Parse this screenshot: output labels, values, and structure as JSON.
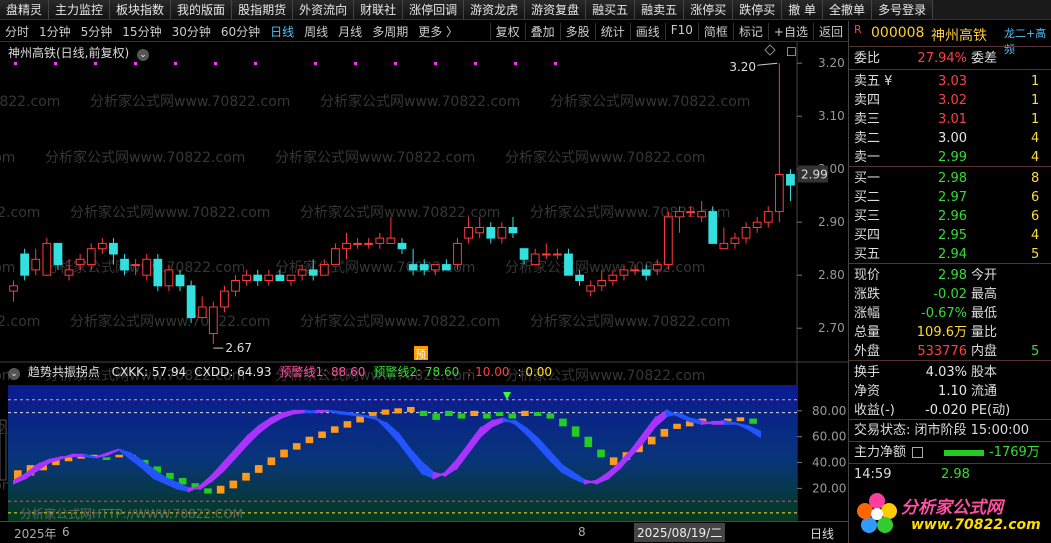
{
  "toolbar": [
    "盘精灵",
    "主力监控",
    "板块指数",
    "我的版面",
    "股指期货",
    "外资流向",
    "财联社",
    "涨停回调",
    "游资龙虎",
    "游资复盘",
    "融买五",
    "融卖五",
    "涨停买",
    "跌停买",
    "撤 单",
    "全撤单",
    "多号登录"
  ],
  "timeframes": [
    "分时",
    "1分钟",
    "5分钟",
    "15分钟",
    "30分钟",
    "60分钟",
    "日线",
    "周线",
    "月线",
    "多周期",
    "更多 〉"
  ],
  "active_timeframe": "日线",
  "right_tools": [
    "复权",
    "叠加",
    "多股",
    "统计",
    "画线",
    "F10",
    "简框",
    "标记",
    "+自选",
    "返回"
  ],
  "chart_title": "神州高铁(日线,前复权)",
  "price_axis": [
    "3.20",
    "3.10",
    "3.00",
    "2.90",
    "2.80",
    "2.70"
  ],
  "current_price_tag": "2.99",
  "annotation_high": "3.20",
  "annotation_low": "2.67",
  "yu_label": "预",
  "indicator": {
    "name": "趋势共振拐点",
    "items": [
      {
        "label": "CXKK: 57.94",
        "color": "#e6e6e6"
      },
      {
        "label": "CXDD: 64.93",
        "color": "#e6e6e6"
      },
      {
        "label": "预警线1: 88.60",
        "color": "#ff4fa0"
      },
      {
        "label": "预警线2: 78.60",
        "color": "#33dd33"
      },
      {
        "label": ": 10.00",
        "color": "#ff4040"
      },
      {
        "label": ": 0.00",
        "color": "#ffdd33"
      }
    ],
    "axis": [
      "80.00",
      "60.00",
      "40.00",
      "20.00"
    ]
  },
  "date_axis": {
    "year": "2025年",
    "m1": "6",
    "m2": "8",
    "cursor_date": "2025/08/19/二",
    "period": "日线"
  },
  "watermark_text": "分析家公式网www.70822.com",
  "footer_watermark": "分析家公式网HTTP://WWW.70822.COM",
  "stock": {
    "code_flag": "R",
    "code": "000008",
    "name": "神州高铁",
    "extra": "龙二+高频"
  },
  "wei_bi": {
    "label": "委比",
    "value": "27.94%",
    "label2": "委差"
  },
  "asks": [
    {
      "label": "卖五 ¥",
      "price": "3.03",
      "vol": "1",
      "color": "red"
    },
    {
      "label": "卖四",
      "price": "3.02",
      "vol": "1",
      "color": "red"
    },
    {
      "label": "卖三",
      "price": "3.01",
      "vol": "1",
      "color": "red"
    },
    {
      "label": "卖二",
      "price": "3.00",
      "vol": "4",
      "color": "white"
    },
    {
      "label": "卖一",
      "price": "2.99",
      "vol": "4",
      "color": "green"
    }
  ],
  "bids": [
    {
      "label": "买一",
      "price": "2.98",
      "vol": "8",
      "color": "green"
    },
    {
      "label": "买二",
      "price": "2.97",
      "vol": "6",
      "color": "green"
    },
    {
      "label": "买三",
      "price": "2.96",
      "vol": "6",
      "color": "green"
    },
    {
      "label": "买四",
      "price": "2.95",
      "vol": "4",
      "color": "green"
    },
    {
      "label": "买五",
      "price": "2.94",
      "vol": "5",
      "color": "green"
    }
  ],
  "quote": [
    {
      "l": "现价",
      "v": "2.98",
      "c": "green",
      "l2": "今开"
    },
    {
      "l": "涨跌",
      "v": "-0.02",
      "c": "green",
      "l2": "最高"
    },
    {
      "l": "涨幅",
      "v": "-0.67%",
      "c": "green",
      "l2": "最低"
    },
    {
      "l": "总量",
      "v": "109.6万",
      "c": "yellow",
      "l2": "量比"
    },
    {
      "l": "外盘",
      "v": "533776",
      "c": "red",
      "l2": "内盘",
      "v2": "5"
    }
  ],
  "quote2": [
    {
      "l": "换手",
      "v": "4.03%",
      "c": "white",
      "l2": "股本"
    },
    {
      "l": "净资",
      "v": "1.10",
      "c": "white",
      "l2": "流通"
    },
    {
      "l": "收益(-)",
      "v": "-0.020",
      "c": "white",
      "l2": "PE(动)"
    }
  ],
  "trade_status": "交易状态: 闭市阶段 15:00:00",
  "main_net": {
    "label": "主力净额",
    "value": "-1769万"
  },
  "tick": {
    "time": "14:59",
    "price": "2.98"
  },
  "logo": {
    "text": "分析家公式网",
    "url": "www.70822.com"
  },
  "chart_data": {
    "type": "candlestick",
    "ylim": [
      2.64,
      3.24
    ],
    "candles": [
      [
        2.77,
        2.79,
        2.75,
        2.78
      ],
      [
        2.84,
        2.85,
        2.79,
        2.8
      ],
      [
        2.81,
        2.85,
        2.8,
        2.83
      ],
      [
        2.8,
        2.87,
        2.8,
        2.86
      ],
      [
        2.86,
        2.86,
        2.81,
        2.82
      ],
      [
        2.8,
        2.83,
        2.79,
        2.81
      ],
      [
        2.82,
        2.84,
        2.81,
        2.83
      ],
      [
        2.82,
        2.86,
        2.81,
        2.85
      ],
      [
        2.85,
        2.87,
        2.84,
        2.86
      ],
      [
        2.86,
        2.87,
        2.82,
        2.84
      ],
      [
        2.83,
        2.84,
        2.8,
        2.81
      ],
      [
        2.82,
        2.83,
        2.8,
        2.82
      ],
      [
        2.8,
        2.84,
        2.79,
        2.83
      ],
      [
        2.83,
        2.84,
        2.77,
        2.78
      ],
      [
        2.78,
        2.82,
        2.77,
        2.81
      ],
      [
        2.8,
        2.81,
        2.77,
        2.78
      ],
      [
        2.78,
        2.79,
        2.71,
        2.72
      ],
      [
        2.72,
        2.76,
        2.72,
        2.74
      ],
      [
        2.69,
        2.75,
        2.67,
        2.74
      ],
      [
        2.74,
        2.78,
        2.73,
        2.77
      ],
      [
        2.77,
        2.8,
        2.76,
        2.79
      ],
      [
        2.79,
        2.81,
        2.78,
        2.8
      ],
      [
        2.8,
        2.81,
        2.78,
        2.79
      ],
      [
        2.79,
        2.81,
        2.78,
        2.8
      ],
      [
        2.8,
        2.81,
        2.79,
        2.79
      ],
      [
        2.79,
        2.8,
        2.78,
        2.8
      ],
      [
        2.8,
        2.82,
        2.79,
        2.81
      ],
      [
        2.81,
        2.83,
        2.79,
        2.8
      ],
      [
        2.8,
        2.83,
        2.8,
        2.82
      ],
      [
        2.82,
        2.86,
        2.82,
        2.85
      ],
      [
        2.85,
        2.88,
        2.83,
        2.86
      ],
      [
        2.86,
        2.87,
        2.85,
        2.86
      ],
      [
        2.86,
        2.87,
        2.85,
        2.86
      ],
      [
        2.86,
        2.88,
        2.85,
        2.87
      ],
      [
        2.86,
        2.91,
        2.86,
        2.87
      ],
      [
        2.86,
        2.87,
        2.84,
        2.85
      ],
      [
        2.82,
        2.85,
        2.8,
        2.81
      ],
      [
        2.82,
        2.83,
        2.8,
        2.81
      ],
      [
        2.81,
        2.82,
        2.8,
        2.82
      ],
      [
        2.82,
        2.83,
        2.81,
        2.81
      ],
      [
        2.82,
        2.87,
        2.81,
        2.86
      ],
      [
        2.87,
        2.91,
        2.86,
        2.89
      ],
      [
        2.88,
        2.91,
        2.87,
        2.89
      ],
      [
        2.89,
        2.9,
        2.86,
        2.87
      ],
      [
        2.87,
        2.9,
        2.86,
        2.89
      ],
      [
        2.89,
        2.91,
        2.87,
        2.88
      ],
      [
        2.85,
        2.85,
        2.82,
        2.83
      ],
      [
        2.82,
        2.85,
        2.82,
        2.84
      ],
      [
        2.84,
        2.86,
        2.83,
        2.84
      ],
      [
        2.84,
        2.85,
        2.83,
        2.84
      ],
      [
        2.84,
        2.85,
        2.8,
        2.8
      ],
      [
        2.8,
        2.81,
        2.78,
        2.79
      ],
      [
        2.77,
        2.79,
        2.76,
        2.78
      ],
      [
        2.78,
        2.81,
        2.77,
        2.79
      ],
      [
        2.79,
        2.81,
        2.78,
        2.8
      ],
      [
        2.8,
        2.82,
        2.79,
        2.81
      ],
      [
        2.81,
        2.82,
        2.8,
        2.81
      ],
      [
        2.81,
        2.82,
        2.79,
        2.8
      ],
      [
        2.81,
        2.83,
        2.8,
        2.82
      ],
      [
        2.82,
        2.92,
        2.81,
        2.91
      ],
      [
        2.91,
        2.93,
        2.88,
        2.92
      ],
      [
        2.92,
        2.93,
        2.91,
        2.92
      ],
      [
        2.91,
        2.94,
        2.9,
        2.92
      ],
      [
        2.92,
        2.93,
        2.86,
        2.86
      ],
      [
        2.85,
        2.89,
        2.85,
        2.86
      ],
      [
        2.86,
        2.88,
        2.85,
        2.87
      ],
      [
        2.87,
        2.9,
        2.86,
        2.89
      ],
      [
        2.89,
        2.91,
        2.88,
        2.9
      ],
      [
        2.9,
        2.93,
        2.89,
        2.92
      ],
      [
        2.92,
        3.2,
        2.9,
        2.99
      ],
      [
        2.99,
        3.0,
        2.94,
        2.97
      ]
    ],
    "cxkk": [
      26,
      31,
      38,
      42,
      44,
      45,
      45,
      44,
      47,
      50,
      43,
      36,
      28,
      24,
      20,
      18,
      22,
      30,
      40,
      50,
      60,
      68,
      74,
      78,
      80,
      80,
      79,
      80,
      79,
      78,
      76,
      75,
      66,
      56,
      44,
      32,
      28,
      32,
      42,
      54,
      66,
      72,
      74,
      70,
      62,
      52,
      42,
      33,
      28,
      24,
      26,
      32,
      40,
      50,
      62,
      74,
      80,
      76,
      72,
      70,
      71,
      72,
      70,
      66,
      60
    ],
    "cxdd": [
      24,
      28,
      34,
      40,
      43,
      46,
      46,
      44,
      46,
      50,
      47,
      41,
      34,
      28,
      24,
      20,
      20,
      26,
      34,
      44,
      54,
      63,
      70,
      75,
      78,
      79,
      80,
      80,
      78,
      77,
      76,
      74,
      70,
      62,
      50,
      40,
      32,
      30,
      36,
      48,
      60,
      68,
      72,
      72,
      66,
      58,
      48,
      38,
      32,
      26,
      24,
      28,
      36,
      46,
      56,
      68,
      76,
      78,
      74,
      72,
      70,
      70,
      70,
      68,
      64
    ],
    "bars": [
      [
        34,
        26,
        "o"
      ],
      [
        38,
        30,
        "o"
      ],
      [
        40,
        34,
        "o"
      ],
      [
        43,
        38,
        "o"
      ],
      [
        44,
        41,
        "o"
      ],
      [
        46,
        43,
        "o"
      ],
      [
        46,
        44,
        "o"
      ],
      [
        44,
        42,
        "g"
      ],
      [
        46,
        44,
        "o"
      ],
      [
        46,
        44,
        "o"
      ],
      [
        42,
        37,
        "g"
      ],
      [
        37,
        32,
        "g"
      ],
      [
        32,
        27,
        "g"
      ],
      [
        28,
        23,
        "g"
      ],
      [
        24,
        20,
        "g"
      ],
      [
        20,
        16,
        "g"
      ],
      [
        22,
        16,
        "o"
      ],
      [
        26,
        20,
        "o"
      ],
      [
        32,
        26,
        "o"
      ],
      [
        38,
        32,
        "o"
      ],
      [
        44,
        38,
        "o"
      ],
      [
        50,
        44,
        "o"
      ],
      [
        55,
        50,
        "o"
      ],
      [
        60,
        55,
        "o"
      ],
      [
        64,
        59,
        "o"
      ],
      [
        68,
        63,
        "o"
      ],
      [
        72,
        67,
        "o"
      ],
      [
        76,
        71,
        "o"
      ],
      [
        79,
        75,
        "o"
      ],
      [
        81,
        77,
        "o"
      ],
      [
        82,
        78,
        "o"
      ],
      [
        83,
        79,
        "o"
      ],
      [
        80,
        76,
        "g"
      ],
      [
        78,
        73,
        "g"
      ],
      [
        80,
        76,
        "g"
      ],
      [
        78,
        74,
        "g"
      ],
      [
        80,
        76,
        "o"
      ],
      [
        78,
        74,
        "g"
      ],
      [
        79,
        76,
        "g"
      ],
      [
        78,
        74,
        "g"
      ],
      [
        80,
        76,
        "o"
      ],
      [
        79,
        76,
        "g"
      ],
      [
        78,
        74,
        "g"
      ],
      [
        74,
        68,
        "g"
      ],
      [
        68,
        60,
        "g"
      ],
      [
        60,
        52,
        "g"
      ],
      [
        50,
        44,
        "g"
      ],
      [
        44,
        38,
        "o"
      ],
      [
        48,
        42,
        "o"
      ],
      [
        54,
        48,
        "o"
      ],
      [
        60,
        54,
        "o"
      ],
      [
        66,
        60,
        "o"
      ],
      [
        70,
        66,
        "o"
      ],
      [
        72,
        68,
        "o"
      ],
      [
        74,
        70,
        "o"
      ],
      [
        72,
        70,
        "o"
      ],
      [
        74,
        72,
        "o"
      ],
      [
        75,
        72,
        "o"
      ],
      [
        74,
        70,
        "g"
      ]
    ]
  }
}
